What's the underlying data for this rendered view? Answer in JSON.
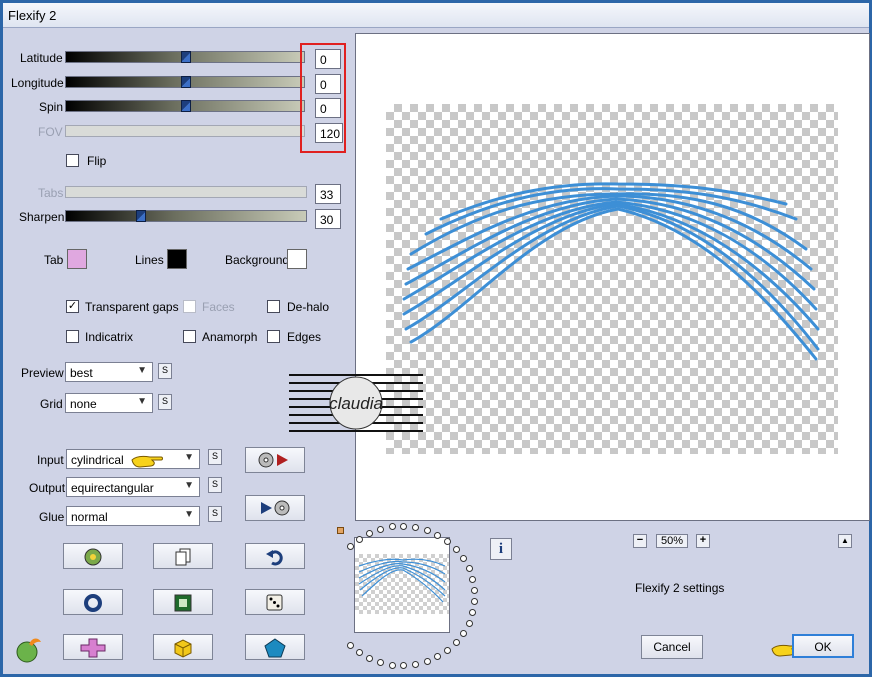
{
  "window": {
    "title": "Flexify 2"
  },
  "controls": {
    "latitude": {
      "label": "Latitude",
      "value": "0"
    },
    "longitude": {
      "label": "Longitude",
      "value": "0"
    },
    "spin": {
      "label": "Spin",
      "value": "0"
    },
    "fov": {
      "label": "FOV",
      "value": "120"
    },
    "flip": {
      "label": "Flip",
      "checked": false
    },
    "tabs": {
      "label": "Tabs",
      "value": "33"
    },
    "sharpen": {
      "label": "Sharpen",
      "value": "30"
    }
  },
  "swatches": {
    "tab": {
      "label": "Tab",
      "color": "#e0a8e0"
    },
    "lines": {
      "label": "Lines",
      "color": "#000000"
    },
    "background": {
      "label": "Background",
      "color": "#ffffff"
    }
  },
  "options": {
    "transparent_gaps": {
      "label": "Transparent gaps",
      "checked": true
    },
    "faces": {
      "label": "Faces",
      "checked": false
    },
    "de_halo": {
      "label": "De-halo",
      "checked": false
    },
    "indicatrix": {
      "label": "Indicatrix",
      "checked": false
    },
    "anamorph": {
      "label": "Anamorph",
      "checked": false
    },
    "edges": {
      "label": "Edges",
      "checked": false
    }
  },
  "selects": {
    "preview": {
      "label": "Preview",
      "value": "best"
    },
    "grid": {
      "label": "Grid",
      "value": "none"
    },
    "input": {
      "label": "Input",
      "value": "cylindrical"
    },
    "output": {
      "label": "Output",
      "value": "equirectangular"
    },
    "glue": {
      "label": "Glue",
      "value": "normal"
    }
  },
  "small_button": "S",
  "watermark": {
    "text": "claudia"
  },
  "zoom": {
    "value": "50%",
    "minus": "−",
    "plus": "+"
  },
  "scroll_up": "▲",
  "settings_label": "Flexify 2 settings",
  "buttons": {
    "cancel": "Cancel",
    "ok": "OK"
  },
  "colors": {
    "accent": "#2c66a8",
    "stroke": "#3d8fd6",
    "highlight": "#e02020"
  }
}
